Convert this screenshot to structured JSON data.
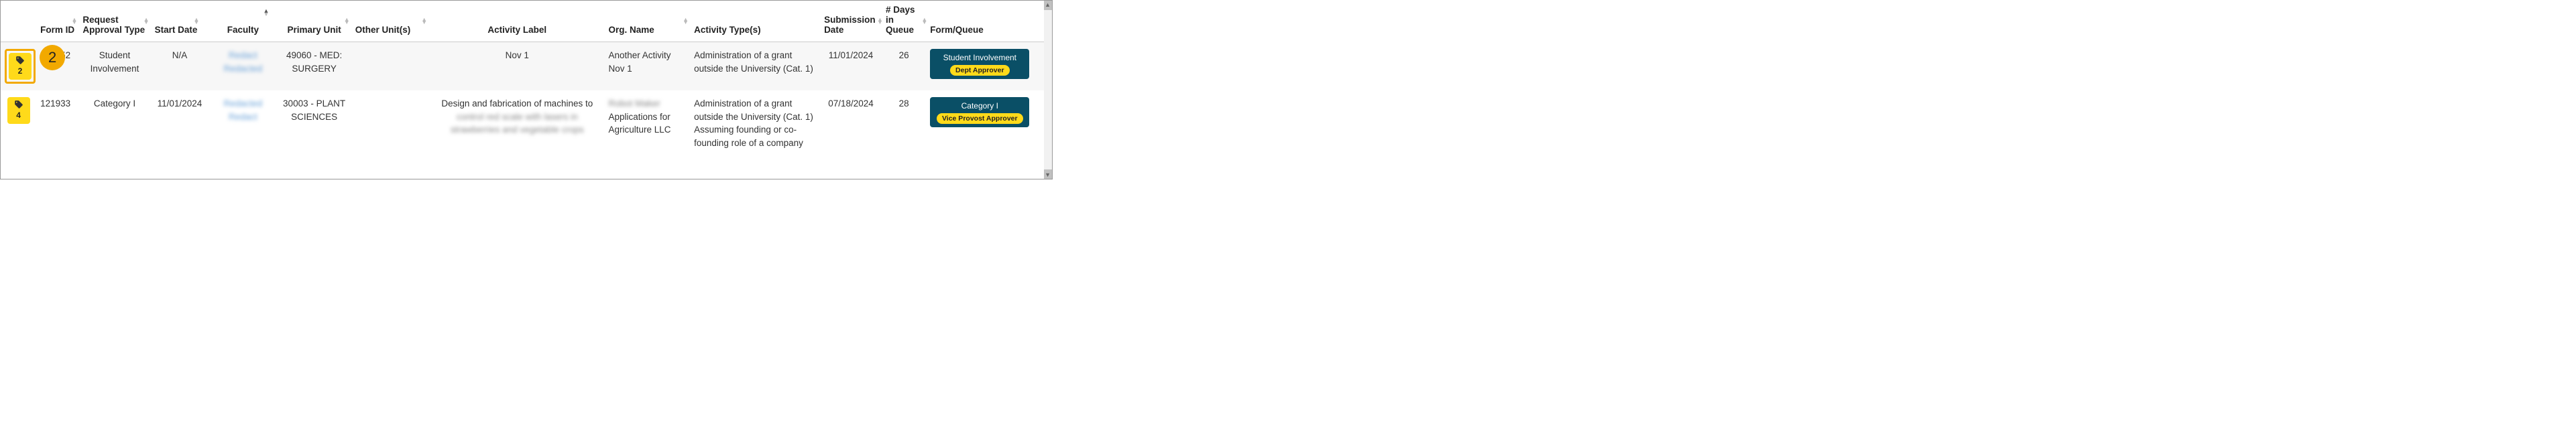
{
  "columns": {
    "form_id": "Form ID",
    "request_approval_type": "Request Approval Type",
    "start_date": "Start Date",
    "faculty": "Faculty",
    "primary_unit": "Primary Unit",
    "other_units": "Other Unit(s)",
    "activity_label": "Activity Label",
    "org_name": "Org. Name",
    "activity_types": "Activity Type(s)",
    "submission_date": "Submission Date",
    "days_in_queue": "# Days in Queue",
    "form_queue": "Form/Queue"
  },
  "callout": {
    "number": "2"
  },
  "rows": [
    {
      "tag_count": "2",
      "form_id": "136252",
      "approval_type": "Student Involvement",
      "start_date": "N/A",
      "faculty_line1": "Redact",
      "faculty_line2": "Redacted",
      "primary_unit": "49060 - MED: SURGERY",
      "other_units": "",
      "activity_label": "Nov 1",
      "org_name": "Another Activity Nov 1",
      "activity_types": "Administration of a grant outside the University (Cat. 1)",
      "submission_date": "11/01/2024",
      "days_in_queue": "26",
      "form_queue_main": "Student Involvement",
      "form_queue_sub": "Dept Approver"
    },
    {
      "tag_count": "4",
      "form_id": "121933",
      "approval_type": "Category I",
      "start_date": "11/01/2024",
      "faculty_line1": "Redacted",
      "faculty_line2": "Redact",
      "primary_unit": "30003 - PLANT SCIENCES",
      "other_units": "",
      "activity_label_visible": "Design and fabrication of machines to",
      "activity_label_blur1": "control red scale with lasers in",
      "activity_label_blur2": "strawberries and vegetable crops",
      "org_name_blur": "Robot Maker",
      "org_name_visible": "Applications for Agriculture LLC",
      "activity_types": "Administration of a grant outside the University (Cat. 1)",
      "activity_types_2": "Assuming founding or co-founding role of a company",
      "submission_date": "07/18/2024",
      "days_in_queue": "28",
      "form_queue_main": "Category I",
      "form_queue_sub": "Vice Provost Approver"
    }
  ]
}
